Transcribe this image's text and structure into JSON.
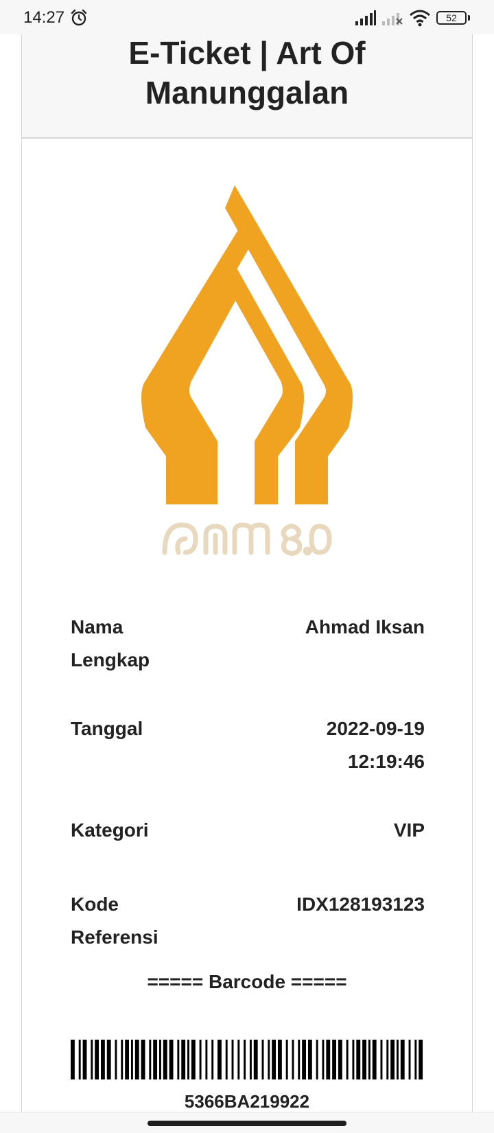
{
  "status_bar": {
    "time": "14:27",
    "battery": "52",
    "icons": [
      "alarm-icon",
      "signal-icon",
      "signal-off-icon",
      "wifi-icon",
      "battery-icon"
    ]
  },
  "ticket": {
    "title": "E-Ticket | Art Of Manunggalan",
    "logo": {
      "name": "gunungan-logo",
      "color": "#f0a320",
      "caption": "ꦄꦺꦴꦩ꧀ ꧘꧐",
      "caption_color": "#e8d8bd"
    },
    "details": [
      {
        "label": "Nama Lengkap",
        "value": "Ahmad Iksan"
      },
      {
        "label": "Tanggal",
        "value": "2022-09-19 12:19:46"
      },
      {
        "label": "Kategori",
        "value": "VIP"
      },
      {
        "label": "Kode Referensi",
        "value": "IDX128193123"
      }
    ],
    "barcode_title": "===== Barcode =====",
    "barcode_number": "5366BA219922"
  }
}
